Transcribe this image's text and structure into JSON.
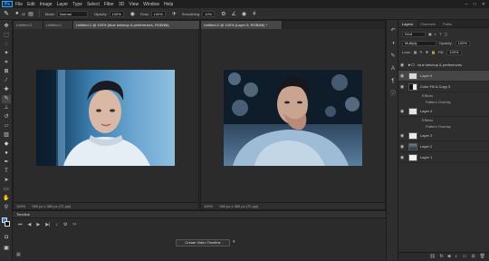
{
  "menu": {
    "logo": "Ps",
    "items": [
      "File",
      "Edit",
      "Image",
      "Layer",
      "Type",
      "Select",
      "Filter",
      "3D",
      "View",
      "Window",
      "Help"
    ]
  },
  "options": {
    "mode_label": "Mode:",
    "mode_value": "Normal",
    "opacity_label": "Opacity:",
    "opacity_value": "100%",
    "flow_label": "Flow:",
    "flow_value": "100%",
    "smoothing_label": "Smoothing:",
    "smoothing_value": "10%",
    "brush_size": "42"
  },
  "tabs_left": [
    "Untitled-3",
    "Untitled-1",
    "Untitled-1 @ 100% (blue ketchup & preferences, RGB/8#)"
  ],
  "tabs_right": [
    "Untitled-2 @ 100% (Layer 6, RGB/8#) *"
  ],
  "status_left": {
    "zoom": "100%",
    "info": "960 px x 360 px (72 ppi)"
  },
  "status_right": {
    "zoom": "100%",
    "info": "960 px x 360 px (72 ppi)"
  },
  "timeline": {
    "title": "Timeline",
    "create_button": "Create Video Timeline"
  },
  "layers_panel": {
    "tabs": [
      "Layers",
      "Channels",
      "Paths"
    ],
    "kind_label": "Kind",
    "blend_mode": "Multiply",
    "opacity_label": "Opacity:",
    "opacity_value": "100%",
    "lock_label": "Lock:",
    "fill_label": "Fill:",
    "fill_value": "100%",
    "layers": [
      {
        "name": "blue ketchup & preferences",
        "type": "group"
      },
      {
        "name": "Layer 6",
        "type": "layer"
      },
      {
        "name": "Color Fill & Copy 5",
        "type": "fill"
      },
      {
        "name": "Layer 4",
        "type": "layer"
      },
      {
        "name": "Layer 3",
        "type": "layer"
      },
      {
        "name": "Layer 2",
        "type": "layer"
      },
      {
        "name": "Layer 1",
        "type": "layer"
      }
    ],
    "effects_label": "Effects",
    "pattern_overlay": "Pattern Overlay"
  },
  "colors": {
    "accent": "#31a8ff",
    "foreground": "#2d7be0",
    "background": "#111111"
  }
}
